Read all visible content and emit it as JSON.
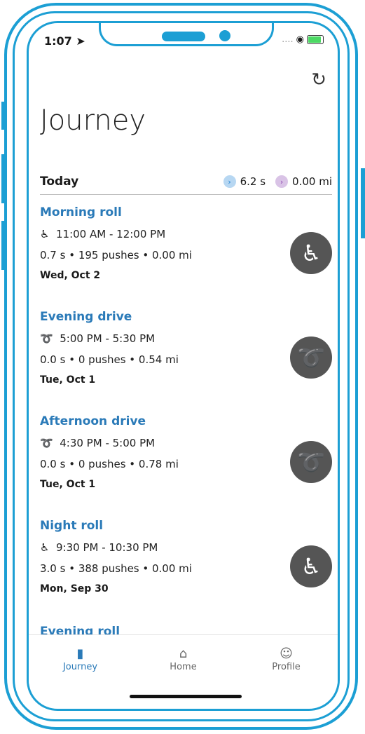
{
  "status": {
    "time": "1:07",
    "dots": "....",
    "wifi": "◉"
  },
  "header": {
    "title": "Journey",
    "refresh_icon": "↻"
  },
  "today": {
    "label": "Today",
    "time_stat": "6.2 s",
    "distance_stat": "0.00 mi"
  },
  "entries": [
    {
      "title": "Morning roll",
      "kind_icon": "wheelchair-icon",
      "icon_glyph": "♿",
      "time_range": "11:00 AM - 12:00 PM",
      "stats": "0.7 s • 195 pushes • 0.00 mi",
      "date": "Wed, Oct 2"
    },
    {
      "title": "Evening drive",
      "kind_icon": "power-assist-icon",
      "icon_glyph": "➰",
      "time_range": "5:00 PM - 5:30 PM",
      "stats": "0.0 s • 0 pushes • 0.54 mi",
      "date": "Tue, Oct 1"
    },
    {
      "title": "Afternoon drive",
      "kind_icon": "power-assist-icon",
      "icon_glyph": "➰",
      "time_range": "4:30 PM - 5:00 PM",
      "stats": "0.0 s • 0 pushes • 0.78 mi",
      "date": "Tue, Oct 1"
    },
    {
      "title": "Night roll",
      "kind_icon": "wheelchair-icon",
      "icon_glyph": "♿",
      "time_range": "9:30 PM - 10:30 PM",
      "stats": "3.0 s • 388 pushes • 0.00 mi",
      "date": "Mon, Sep 30"
    }
  ],
  "partial_entry": {
    "title": "Evening roll"
  },
  "tabs": [
    {
      "label": "Journey",
      "icon": "▮",
      "icon_name": "map-icon"
    },
    {
      "label": "Home",
      "icon": "⌂",
      "icon_name": "home-icon"
    },
    {
      "label": "Profile",
      "icon": "☺",
      "icon_name": "person-icon"
    }
  ],
  "colors": {
    "frame": "#1c9fd4",
    "accent": "#2a7ab8",
    "icon_bg": "#555555"
  }
}
